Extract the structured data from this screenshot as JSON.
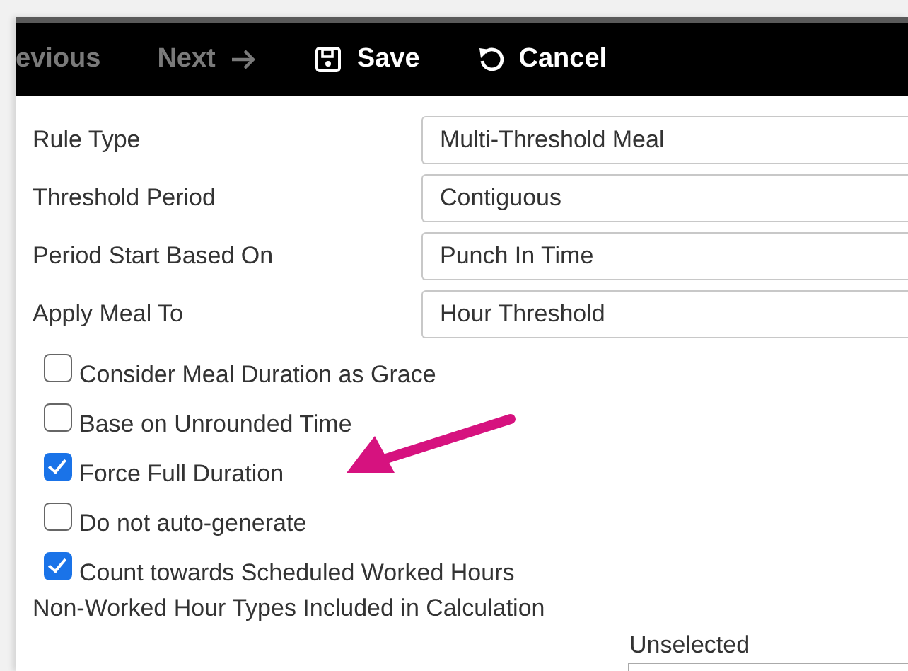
{
  "toolbar": {
    "items": [
      {
        "label": "evious",
        "kind": "previous",
        "disabled": true
      },
      {
        "label": "Next",
        "kind": "next",
        "disabled": true
      },
      {
        "label": "Save",
        "kind": "save",
        "disabled": false
      },
      {
        "label": "Cancel",
        "kind": "cancel",
        "disabled": false
      }
    ]
  },
  "fields": [
    {
      "label": "Rule Type",
      "value": "Multi-Threshold Meal"
    },
    {
      "label": "Threshold Period",
      "value": "Contiguous"
    },
    {
      "label": "Period Start Based On",
      "value": "Punch In Time"
    },
    {
      "label": "Apply Meal To",
      "value": "Hour Threshold"
    }
  ],
  "options": [
    {
      "label": "Consider Meal Duration as Grace",
      "checked": false
    },
    {
      "label": "Base on Unrounded Time",
      "checked": false
    },
    {
      "label": "Force Full Duration",
      "checked": true
    },
    {
      "label": "Do not auto-generate",
      "checked": false
    },
    {
      "label": "Count towards Scheduled Worked Hours",
      "checked": true
    }
  ],
  "section_label": "Non-Worked Hour Types Included in Calculation",
  "unselected_label": "Unselected"
}
